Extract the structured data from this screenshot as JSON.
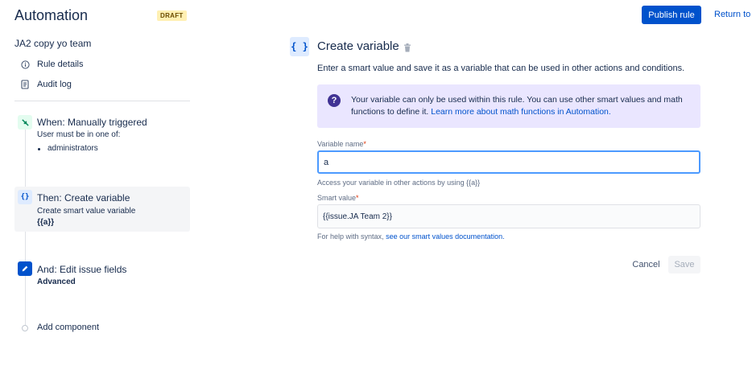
{
  "header": {
    "title": "Automation",
    "badge": "DRAFT",
    "publish_label": "Publish rule",
    "return_label": "Return to"
  },
  "sidebar": {
    "rule_name": "JA2 copy yo team",
    "nav": [
      {
        "label": "Rule details",
        "icon": "info-icon"
      },
      {
        "label": "Audit log",
        "icon": "document-icon"
      }
    ],
    "steps": [
      {
        "title": "When: Manually triggered",
        "subtitle": "User must be in one of:",
        "bullet": "administrators",
        "icon": "trigger-icon",
        "icon_color": "#00875a",
        "icon_bg": "#e3fcef"
      },
      {
        "title": "Then: Create variable",
        "subtitle": "Create smart value variable",
        "detail": "{{a}}",
        "icon": "braces-icon",
        "icon_color": "#0052cc",
        "icon_bg": "#deebff",
        "selected": true
      },
      {
        "title": "And: Edit issue fields",
        "detail": "Advanced",
        "icon": "pencil-icon",
        "icon_color": "#ffffff",
        "icon_bg": "#0052cc"
      }
    ],
    "add_component": "Add component"
  },
  "panel": {
    "icon": "{ }",
    "title": "Create variable",
    "description": "Enter a smart value and save it as a variable that can be used in other actions and conditions.",
    "info": {
      "text": "Your variable can only be used within this rule. You can use other smart values and math functions to define it.",
      "link": "Learn more about math functions in Automation."
    },
    "variable_name": {
      "label": "Variable name",
      "required_mark": "*",
      "value": "a",
      "help": "Access your variable in other actions by using {{a}}"
    },
    "smart_value": {
      "label": "Smart value",
      "required_mark": "*",
      "value": "{{issue.JA Team 2}}",
      "help_prefix": "For help with syntax,",
      "help_link": "see our smart values documentation."
    },
    "cancel_label": "Cancel",
    "save_label": "Save"
  },
  "colors": {
    "primary": "#0052cc",
    "info_bg": "#eae6ff",
    "draft_bg": "#fff0b3"
  }
}
